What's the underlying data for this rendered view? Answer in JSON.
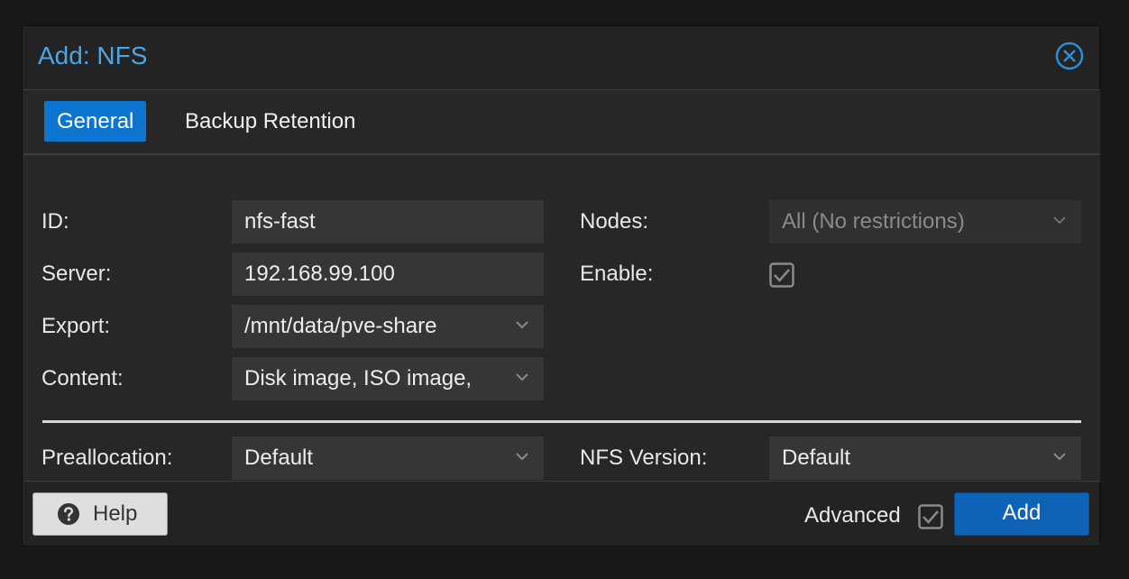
{
  "dialog": {
    "title": "Add: NFS"
  },
  "tabs": [
    {
      "label": "General",
      "active": true
    },
    {
      "label": "Backup Retention",
      "active": false
    }
  ],
  "form": {
    "id": {
      "label": "ID:",
      "value": "nfs-fast"
    },
    "server": {
      "label": "Server:",
      "value": "192.168.99.100"
    },
    "export": {
      "label": "Export:",
      "value": "/mnt/data/pve-share"
    },
    "content": {
      "label": "Content:",
      "value": "Disk image, ISO image,"
    },
    "nodes": {
      "label": "Nodes:",
      "value": "All (No restrictions)"
    },
    "enable": {
      "label": "Enable:",
      "checked": true
    },
    "preallocation": {
      "label": "Preallocation:",
      "value": "Default"
    },
    "nfs_version": {
      "label": "NFS Version:",
      "value": "Default"
    }
  },
  "footer": {
    "help_label": "Help",
    "advanced_label": "Advanced",
    "advanced_checked": true,
    "add_label": "Add"
  },
  "colors": {
    "accent": "#0b75d0",
    "title": "#4ba6e6",
    "add_button": "#0e63b6"
  },
  "icons": {
    "close": "close-circle-icon",
    "help": "question-circle-icon",
    "dropdown": "chevron-down-icon",
    "check": "checkbox-icon"
  }
}
